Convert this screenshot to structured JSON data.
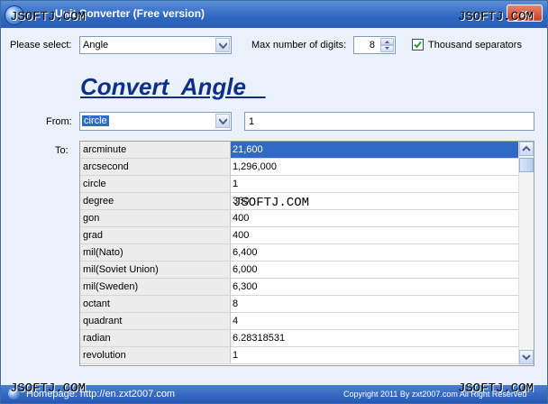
{
  "window": {
    "title": "Unit Converter (Free version)",
    "close_label": "x"
  },
  "watermark": "JSOFTJ.COM",
  "controls": {
    "select_label": "Please select:",
    "category_value": "Angle",
    "max_digits_label": "Max number of digits:",
    "max_digits_value": "8",
    "thousand_sep_label": "Thousand separators",
    "thousand_sep_checked": true
  },
  "heading": "Convert  Angle   ",
  "from": {
    "label": "From:",
    "unit": "circle",
    "value": "1"
  },
  "to": {
    "label": "To:",
    "rows": [
      {
        "unit": "arcminute",
        "value": "21,600",
        "selected": true
      },
      {
        "unit": "arcsecond",
        "value": "1,296,000"
      },
      {
        "unit": "circle",
        "value": "1"
      },
      {
        "unit": "degree",
        "value": "360"
      },
      {
        "unit": "gon",
        "value": "400"
      },
      {
        "unit": "grad",
        "value": "400"
      },
      {
        "unit": "mil(Nato)",
        "value": "6,400"
      },
      {
        "unit": "mil(Soviet Union)",
        "value": "6,000"
      },
      {
        "unit": "mil(Sweden)",
        "value": "6,300"
      },
      {
        "unit": "octant",
        "value": "8"
      },
      {
        "unit": "quadrant",
        "value": "4"
      },
      {
        "unit": "radian",
        "value": "6.28318531"
      },
      {
        "unit": "revolution",
        "value": "1"
      }
    ]
  },
  "status": {
    "homepage": "Homepage: http://en.zxt2007.com",
    "copyright": "Copyright 2011 By zxt2007.com All Right Reserved"
  },
  "colors": {
    "accent": "#316ac5",
    "heading": "#0d2f8a",
    "titlebar": "#2f66c0"
  }
}
